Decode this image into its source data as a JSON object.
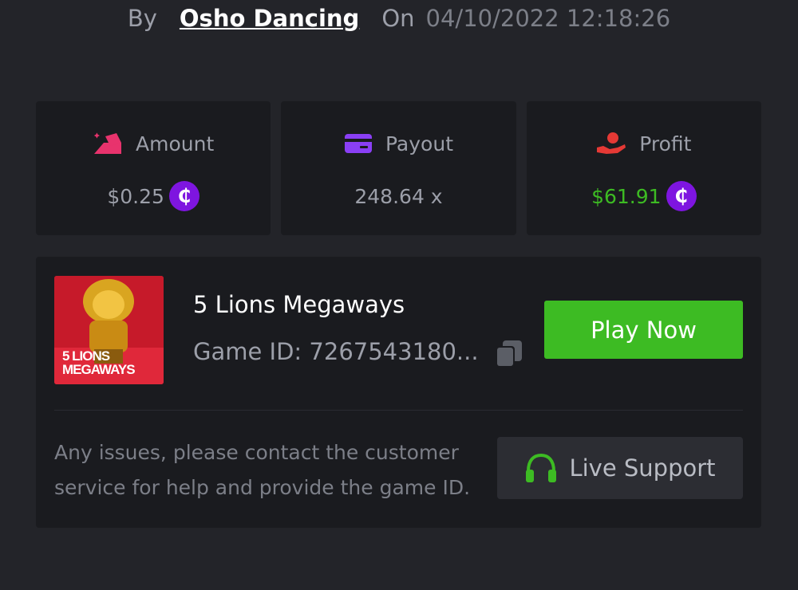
{
  "byline": {
    "by_label": "By",
    "username": "Osho Dancing",
    "on_label": "On",
    "datetime": "04/10/2022 12:18:26"
  },
  "stats": {
    "amount": {
      "label": "Amount",
      "value": "$0.25",
      "icon": "bet-amount-icon",
      "currency_icon": "coin-icon"
    },
    "payout": {
      "label": "Payout",
      "value": "248.64 x",
      "icon": "card-icon"
    },
    "profit": {
      "label": "Profit",
      "value": "$61.91",
      "icon": "hand-profit-icon",
      "currency_icon": "coin-icon"
    }
  },
  "game": {
    "title": "5 Lions Megaways",
    "id_text": "Game ID: 7267543180...",
    "thumb_title_line1": "5 LIONS",
    "thumb_title_line2": "MEGAWAYS",
    "play_label": "Play Now"
  },
  "support": {
    "help_text": "Any issues, please contact the customer service for help and provide the game ID.",
    "button_label": "Live Support",
    "icon": "headset-icon"
  },
  "colors": {
    "background": "#232429",
    "card": "#1a1b1f",
    "accent_green": "#3dbb23",
    "coin_purple": "#7e15e0",
    "amount_pink": "#e8336d",
    "payout_purple": "#8a3ff5",
    "profit_red": "#e53935",
    "muted_text": "#9c9fa9"
  }
}
